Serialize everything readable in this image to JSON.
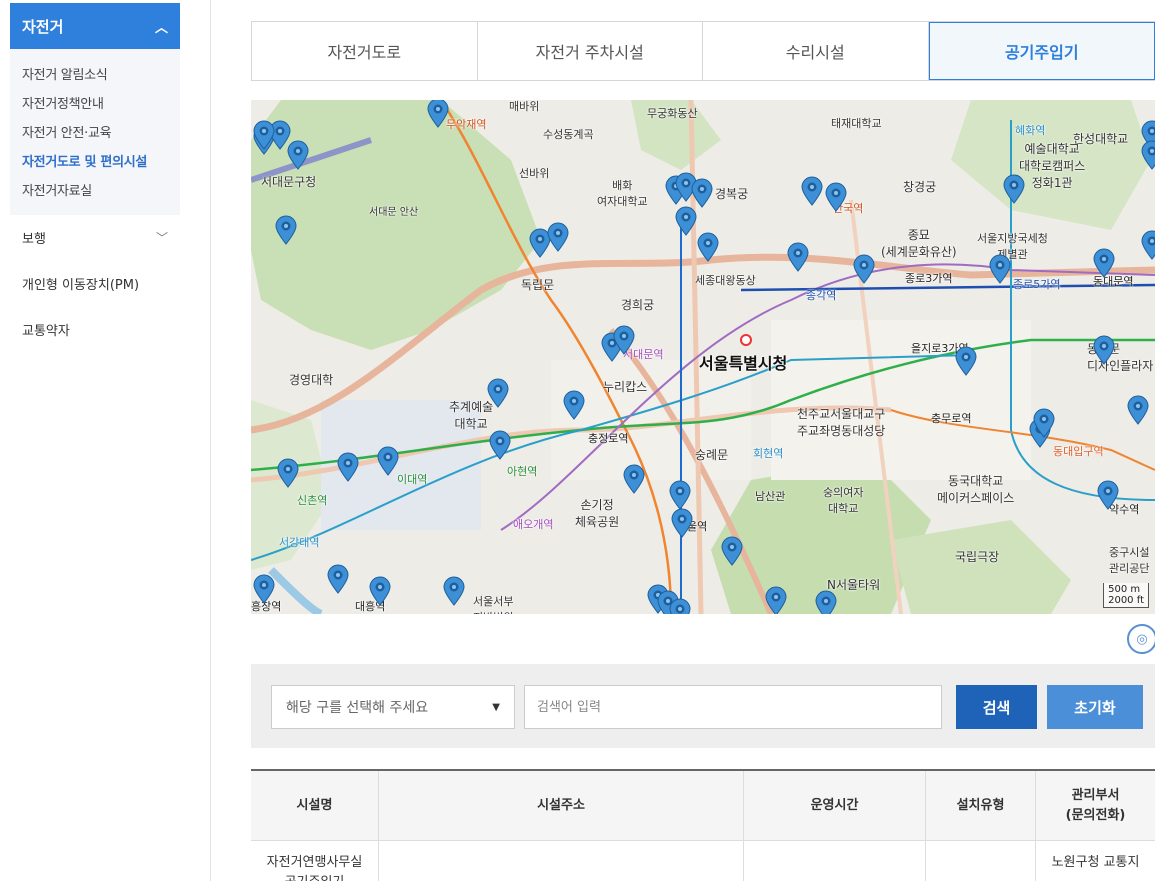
{
  "sidebar": {
    "header": "자전거",
    "sub_items": [
      "자전거 알림소식",
      "자전거정책안내",
      "자전거 안전·교육",
      "자전거도로 및 편의시설",
      "자전거자료실"
    ],
    "menu": [
      "보행",
      "개인형 이동장치(PM)",
      "교통약자"
    ]
  },
  "tabs": [
    "자전거도로",
    "자전거 주차시설",
    "수리시설",
    "공기주입기"
  ],
  "map": {
    "labels": {
      "city_hall": "서울특별시청",
      "dongnimmun": "독립문",
      "gyeonghuigung": "경희궁",
      "gyeongbokgung": "경복궁",
      "changgyeonggung": "창경궁",
      "jongmyo": "종묘\n(세계문화유산)",
      "sungnyemun": "숭례문",
      "n_tower": "N서울타워",
      "seodaemun_gu": "서대문구청",
      "gyeonggi_univ": "경영대학",
      "chugye": "추계예술\n대학교",
      "nurikips": "누리캅스",
      "sogijeong": "손기정\n체육공원",
      "cathedral": "천주교서울대교구\n주교좌명동대성당",
      "dongguk": "동국대학교\n메이커스페이스",
      "national_theater": "국립극장",
      "dongdaemun_plaza": "동대문\n디자인플라자",
      "hanseong": "한성대학교",
      "seoul_arts": "예술대학교\n대학로캠퍼스\n정화1관",
      "muakjae": "무악재역",
      "sinchon": "신촌역",
      "ewha": "이대역",
      "ahyeon": "아현역",
      "chungjeongno": "충정로역",
      "seodaemun": "서대문역",
      "hoehyeon": "회현역",
      "seoul_station": "울역",
      "jonggak": "종각역",
      "jongno3": "종로3가역",
      "jongno5": "종로5가역",
      "dongdaemun": "동대문역",
      "euljiro3": "을지로3가역",
      "chungmuro": "충무로역",
      "ddp": "동대입구역",
      "yaksu": "약수역",
      "seogang": "서강대역",
      "aeogae": "애오개역",
      "hyehwa": "혜화역",
      "anguk": "안국역",
      "seodaemun_mt": "서대문 안산",
      "baehwa": "배화\n여자대학교",
      "seobawi": "선바위",
      "taejae": "태재대학교",
      "muakdong": "무궁화동산",
      "sejong": "세종대왕동상",
      "namsan": "남산관",
      "sookmyung": "숭의여자\n대학교",
      "seoul_fire": "서울지방국세청\n제별관",
      "junggu": "중구시설\n관리공단",
      "maebaek": "매바위",
      "susung": "수성동계곡",
      "heungchang": "흥창역",
      "daeheung": "대흥역",
      "seoulsebu": "서울서부\n지방법원"
    },
    "scale_m": "500 m",
    "scale_ft": "2000 ft"
  },
  "search": {
    "select_placeholder": "해당 구를 선택해 주세요",
    "input_placeholder": "검색어 입력",
    "search_label": "검색",
    "reset_label": "초기화"
  },
  "table": {
    "headers": [
      "시설명",
      "시설주소",
      "운영시간",
      "설치유형",
      "관리부서\n(문의전화)"
    ],
    "rows": [
      [
        "자전거연맹사무실\n공기주입기",
        "",
        "",
        "",
        "노원구청 교통지"
      ]
    ]
  },
  "colors": {
    "accent": "#2f7fdc",
    "accent_dark": "#1f63b8",
    "pin": "#3d8fd6"
  }
}
